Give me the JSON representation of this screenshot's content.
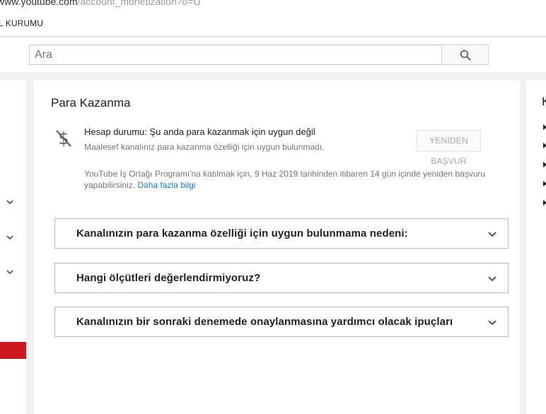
{
  "browser": {
    "url_host": "www.youtube.com",
    "url_path": "/account_monetization?o=U"
  },
  "bookmarks": {
    "item": "L KURUMU"
  },
  "masthead": {
    "search_placeholder": "Ara",
    "search_icon": "search-icon"
  },
  "main": {
    "title": "Para Kazanma",
    "status": {
      "icon": "no-money-icon",
      "title": "Hesap durumu: Şu anda para kazanmak için uygun değil",
      "description": "Maalesef kanalınız para kazanma özelliği için uygun bulunmadı."
    },
    "reapply_label": "YENİDEN BAŞVUR",
    "info_text": "YouTube İş Ortağı Programı'na katılmak için, 9 Haz 2019 tarihinden itibaren 14 gün içinde yeniden başvuru yapabilirsiniz.",
    "info_link": "Daha fazla bilgi",
    "accordions": [
      {
        "label": "Kanalınızın para kazanma özelliği için uygun bulunmama nedeni:"
      },
      {
        "label": "Hangi ölçütleri değerlendirmiyoruz?"
      },
      {
        "label": "Kanalınızın bir sonraki denemede onaylanmasına yardımcı olacak ipuçları"
      }
    ]
  },
  "right_panel": {
    "heading": "K"
  },
  "colors": {
    "accent_red": "#cc181e",
    "link_blue": "#167ac6"
  }
}
